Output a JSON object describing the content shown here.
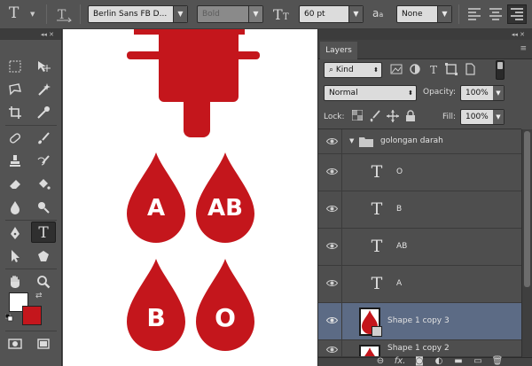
{
  "options_bar": {
    "font_family": "Berlin Sans FB D...",
    "font_style": "Bold",
    "font_size": "60 pt",
    "aa_label": "a",
    "anti_alias": "None",
    "tool_glyph": "T"
  },
  "canvas": {
    "drops": [
      {
        "label": "A",
        "color": "#c4161c"
      },
      {
        "label": "AB",
        "color": "#c4161c"
      },
      {
        "label": "B",
        "color": "#c4161c"
      },
      {
        "label": "O",
        "color": "#c4161c"
      }
    ],
    "blood_bag_color": "#c4161c"
  },
  "panel": {
    "tab_label": "Layers",
    "filter_kind": "Kind",
    "blend_mode": "Normal",
    "opacity_label": "Opacity:",
    "opacity_value": "100%",
    "lock_label": "Lock:",
    "fill_label": "Fill:",
    "fill_value": "100%",
    "layers": [
      {
        "name": "golongan darah",
        "type": "group"
      },
      {
        "name": "O",
        "type": "text"
      },
      {
        "name": "B",
        "type": "text"
      },
      {
        "name": "AB",
        "type": "text"
      },
      {
        "name": "A",
        "type": "text"
      },
      {
        "name": "Shape 1 copy 3",
        "type": "shape",
        "selected": true
      },
      {
        "name": "Shape 1 copy 2",
        "type": "shape"
      }
    ],
    "footer_fx": "fx."
  },
  "colors": {
    "foreground": "#ffffff",
    "background": "#c4161c",
    "selection": "#5c6b85"
  }
}
